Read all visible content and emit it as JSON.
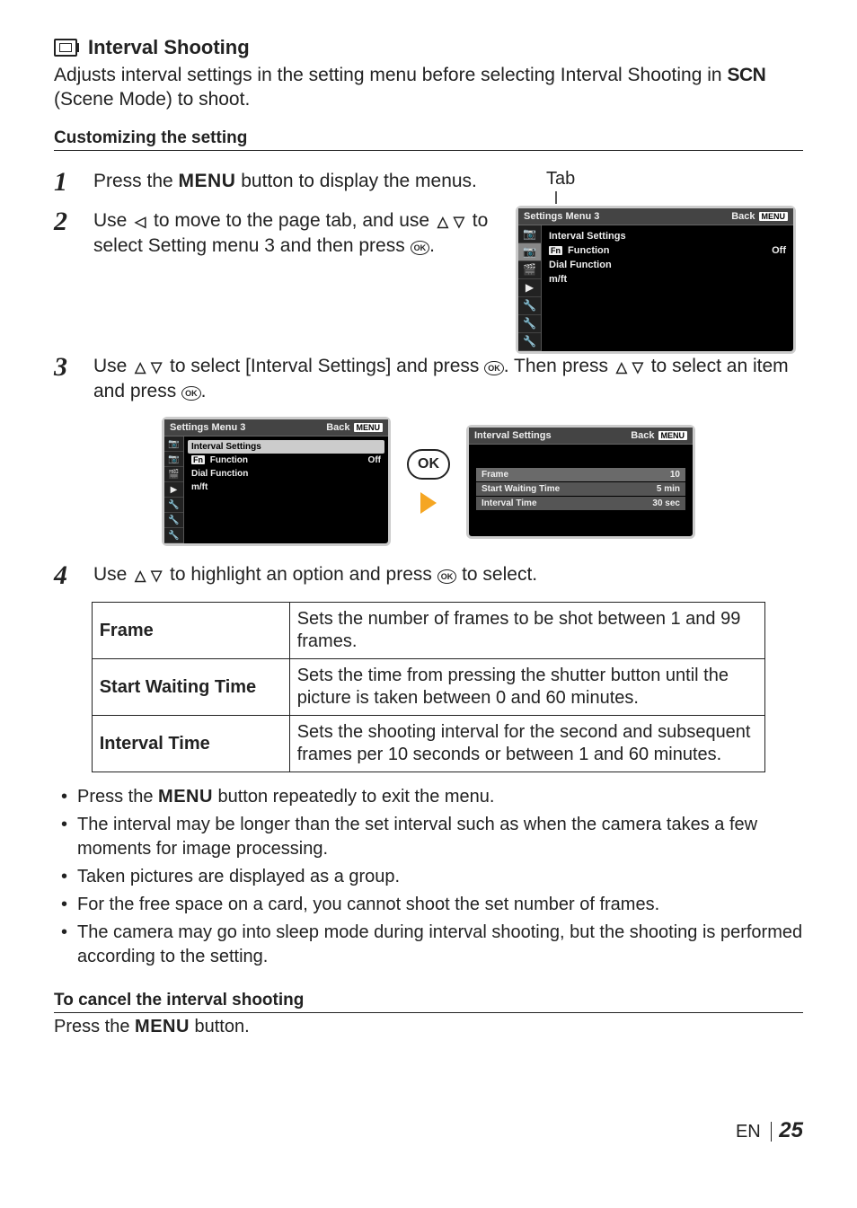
{
  "heading": {
    "title": "Interval Shooting",
    "intro_before_scn": "Adjusts interval settings in the setting menu before selecting Interval Shooting in ",
    "scn": "SCN",
    "intro_after_scn": " (Scene Mode) to shoot."
  },
  "customize_heading": "Customizing the setting",
  "steps": {
    "s1": {
      "num": "1",
      "t1": "Press the ",
      "menu": "MENU",
      "t2": " button to display the menus."
    },
    "s2": {
      "num": "2",
      "t1": "Use ",
      "t2": " to move to the page tab, and use ",
      "t3": " to select Setting menu 3 and then press ",
      "ok": "OK",
      "t4": "."
    },
    "s3": {
      "num": "3",
      "t1": "Use ",
      "t2": " to select [Interval Settings] and press ",
      "ok": "OK",
      "t3": ". Then press ",
      "t4": " to select an item and press ",
      "t5": "."
    },
    "s4": {
      "num": "4",
      "t1": "Use ",
      "t2": " to highlight an option and press ",
      "ok": "OK",
      "t3": " to select."
    }
  },
  "tab_label": "Tab",
  "cam_menu": {
    "header_title": "Settings Menu 3",
    "back": "Back",
    "menu_word": "MENU",
    "items": {
      "interval": "Interval Settings",
      "fn": "Fn",
      "fn_label": " Function",
      "fn_value": "Off",
      "dial": "Dial Function",
      "mft": "m/ft"
    }
  },
  "interval_screen": {
    "header_title": "Interval Settings",
    "back": "Back",
    "menu_word": "MENU",
    "rows": {
      "frame": {
        "k": "Frame",
        "v": "10"
      },
      "swt": {
        "k": "Start Waiting Time",
        "v": "5 min"
      },
      "it": {
        "k": "Interval Time",
        "v": "30 sec"
      }
    }
  },
  "ok_big": "OK",
  "options_table": {
    "frame": {
      "k": "Frame",
      "v": "Sets the number of frames to be shot between 1 and 99 frames."
    },
    "swt": {
      "k": "Start Waiting Time",
      "v": "Sets the time from pressing the shutter button until the picture is taken between 0 and 60 minutes."
    },
    "it": {
      "k": "Interval Time",
      "v": "Sets the shooting interval for the second and subsequent frames per 10 seconds or between 1 and 60 minutes."
    }
  },
  "notes": {
    "n1a": "Press the ",
    "n1_menu": "MENU",
    "n1b": " button repeatedly to exit the menu.",
    "n2": "The interval may be longer than the set interval such as when the camera takes a few moments for image processing.",
    "n3": "Taken pictures are displayed as a group.",
    "n4": "For the free space on a card, you cannot shoot the set number of frames.",
    "n5": "The camera may go into sleep mode during interval shooting, but the shooting is performed according to the setting."
  },
  "cancel": {
    "heading": "To cancel the interval shooting",
    "t1": "Press the ",
    "menu": "MENU",
    "t2": " button."
  },
  "footer": {
    "lang": "EN",
    "page": "25"
  }
}
